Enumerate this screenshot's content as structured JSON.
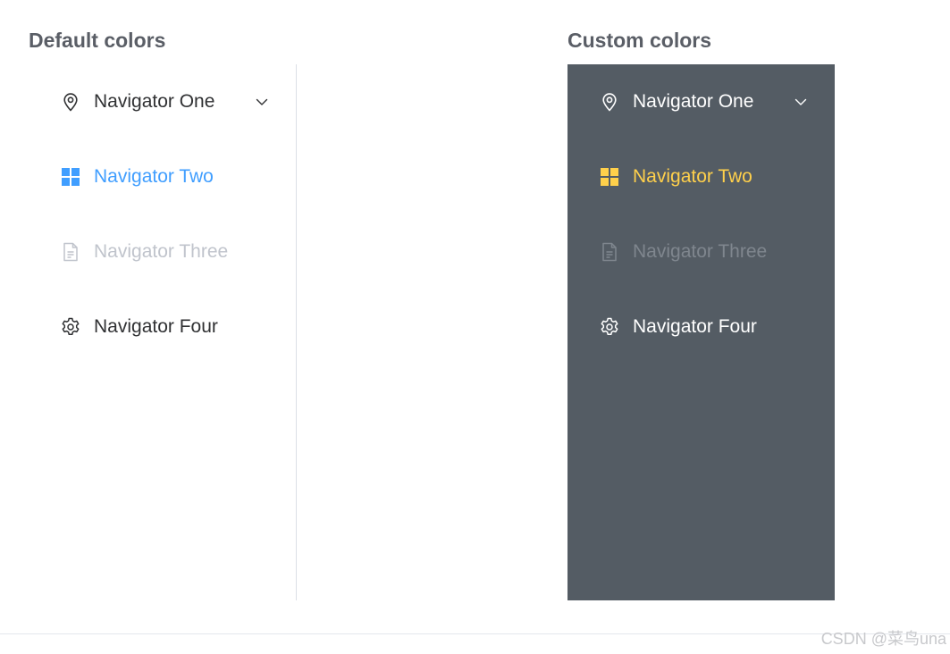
{
  "sections": {
    "default": {
      "title": "Default colors",
      "colors": {
        "text": "#303133",
        "active": "#409eff",
        "disabled": "#c0c4cc",
        "background": "#ffffff"
      },
      "items": [
        {
          "label": "Navigator One",
          "icon": "location-icon",
          "state": "normal",
          "has_submenu": true
        },
        {
          "label": "Navigator Two",
          "icon": "menu-grid-icon",
          "state": "active",
          "has_submenu": false
        },
        {
          "label": "Navigator Three",
          "icon": "document-icon",
          "state": "disabled",
          "has_submenu": false
        },
        {
          "label": "Navigator Four",
          "icon": "gear-icon",
          "state": "normal",
          "has_submenu": false
        }
      ]
    },
    "custom": {
      "title": "Custom colors",
      "colors": {
        "text": "#ffffff",
        "active": "#ffd04b",
        "disabled": "#7f868e",
        "background": "#545c64"
      },
      "items": [
        {
          "label": "Navigator One",
          "icon": "location-icon",
          "state": "normal",
          "has_submenu": true
        },
        {
          "label": "Navigator Two",
          "icon": "menu-grid-icon",
          "state": "active",
          "has_submenu": false
        },
        {
          "label": "Navigator Three",
          "icon": "document-icon",
          "state": "disabled",
          "has_submenu": false
        },
        {
          "label": "Navigator Four",
          "icon": "gear-icon",
          "state": "normal",
          "has_submenu": false
        }
      ]
    }
  },
  "watermark": "CSDN @菜鸟una"
}
